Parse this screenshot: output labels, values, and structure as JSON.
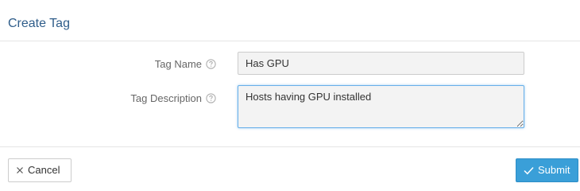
{
  "dialog": {
    "title": "Create Tag"
  },
  "form": {
    "tag_name": {
      "label": "Tag Name",
      "value": "Has GPU",
      "help_icon": "question-circle-icon"
    },
    "tag_description": {
      "label": "Tag Description",
      "value": "Hosts having GPU installed",
      "help_icon": "question-circle-icon"
    }
  },
  "footer": {
    "cancel_label": "Cancel",
    "cancel_icon": "close-icon",
    "submit_label": "Submit",
    "submit_icon": "checkmark-icon"
  },
  "colors": {
    "title": "#2f5d8a",
    "submit_background": "#3a9fd8",
    "focus_border": "#66afe9"
  }
}
